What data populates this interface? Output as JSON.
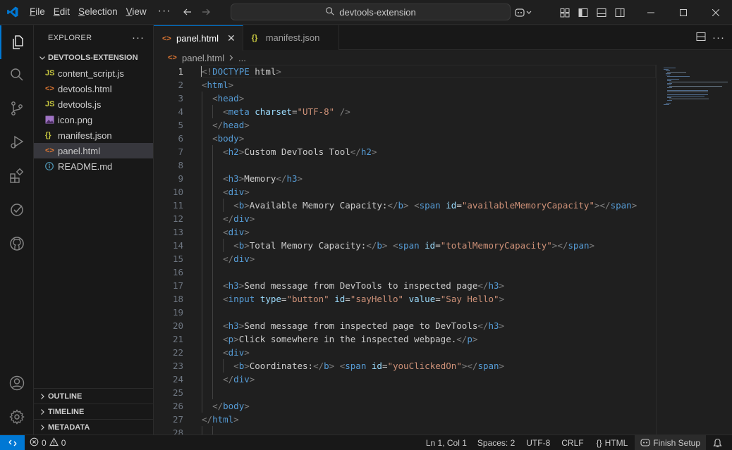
{
  "titlebar": {
    "menu": [
      "File",
      "Edit",
      "Selection",
      "View"
    ],
    "search_text": "devtools-extension"
  },
  "sidebar": {
    "header": "EXPLORER",
    "folder": "DEVTOOLS-EXTENSION",
    "files": [
      {
        "name": "content_script.js",
        "type": "js"
      },
      {
        "name": "devtools.html",
        "type": "html"
      },
      {
        "name": "devtools.js",
        "type": "js"
      },
      {
        "name": "icon.png",
        "type": "png"
      },
      {
        "name": "manifest.json",
        "type": "json"
      },
      {
        "name": "panel.html",
        "type": "html",
        "selected": true
      },
      {
        "name": "README.md",
        "type": "info"
      }
    ],
    "sections": [
      "OUTLINE",
      "TIMELINE",
      "METADATA"
    ]
  },
  "tabs": [
    {
      "label": "panel.html",
      "active": true
    },
    {
      "label": "manifest.json",
      "active": false
    }
  ],
  "breadcrumb": {
    "file": "panel.html",
    "more": "..."
  },
  "code_lines": [
    "<!DOCTYPE html>",
    "<html>",
    "  <head>",
    "    <meta charset=\"UTF-8\" />",
    "  </head>",
    "  <body>",
    "    <h2>Custom DevTools Tool</h2>",
    "",
    "    <h3>Memory</h3>",
    "    <div>",
    "      <b>Available Memory Capacity:</b> <span id=\"availableMemoryCapacity\"></span>",
    "    </div>",
    "    <div>",
    "      <b>Total Memory Capacity:</b> <span id=\"totalMemoryCapacity\"></span>",
    "    </div>",
    "",
    "    <h3>Send message from DevTools to inspected page</h3>",
    "    <input type=\"button\" id=\"sayHello\" value=\"Say Hello\">",
    "",
    "    <h3>Send message from inspected page to DevTools</h3>",
    "    <p>Click somewhere in the inspected webpage.</p>",
    "    <div>",
    "      <b>Coordinates:</b> <span id=\"youClickedOn\"></span>",
    "    </div>",
    "",
    "  </body>",
    "</html>",
    ""
  ],
  "statusbar": {
    "errors": "0",
    "warnings": "0",
    "position": "Ln 1, Col 1",
    "spaces": "Spaces: 2",
    "encoding": "UTF-8",
    "eol": "CRLF",
    "language": "HTML",
    "finish_setup": "Finish Setup"
  },
  "colors": {
    "accent": "#0078d4",
    "tag": "#569cd6",
    "attr": "#9cdcfe",
    "string": "#ce9178"
  }
}
